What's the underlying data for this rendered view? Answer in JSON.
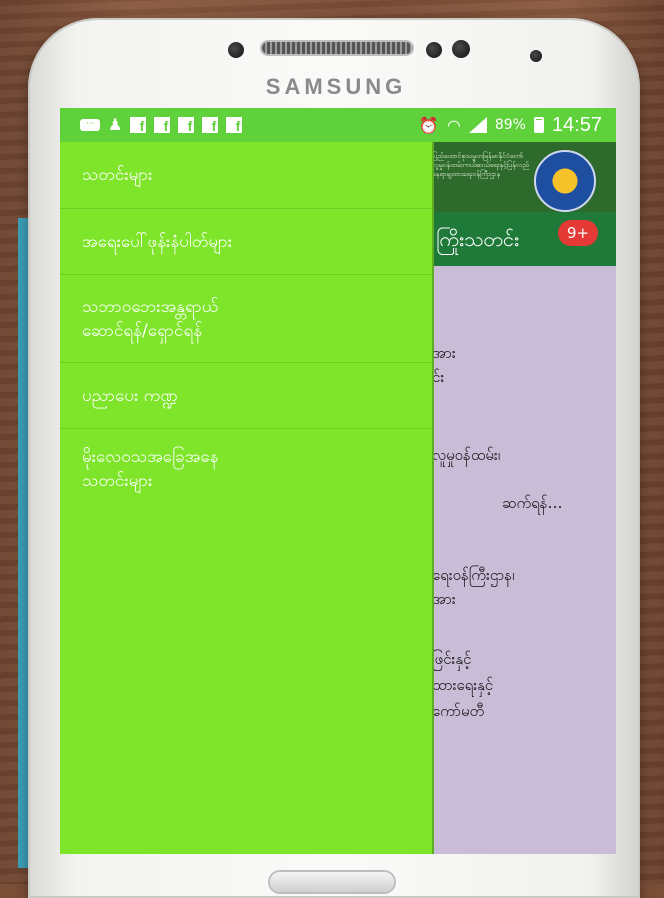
{
  "device": {
    "brand": "SAMSUNG"
  },
  "status_bar": {
    "battery": "89%",
    "time": "14:57",
    "notification_icons": [
      "message-icon",
      "person-icon",
      "facebook-icon",
      "facebook-icon",
      "facebook-icon",
      "facebook-icon",
      "facebook-icon",
      "alarm-icon",
      "wifi-icon",
      "signal-icon",
      "battery-icon"
    ]
  },
  "drawer": {
    "items": [
      {
        "label": "သတင်းများ"
      },
      {
        "label": "အရေးပေါ်ဖုန်းနံပါတ်များ"
      },
      {
        "label": "သဘာဝဘေးအန္တရာယ်\nဆောင်ရန်/ရှောင်ရန်"
      },
      {
        "label": "ပညာပေး ကဏ္ဍ"
      },
      {
        "label": "မိုးလေဝသအခြေအနေ\nသတင်းများ"
      }
    ]
  },
  "app": {
    "header_text": "ပြည်ထောင်စုသမ္မတမြန်မာနိုင်ငံတော် လူမှုဝန်ထမ်းကယ်ဆယ်ရေးနှင့်ပြန်လည်နေရာချထားရေးဝန်ကြီးဌာန",
    "tab_label": "ကြိုးသတင်း",
    "badge": "9+",
    "body_lines": [
      "အား",
      "င်း",
      "လူမှုဝန်ထမ်း၊",
      "ဆက်ရန်…",
      "ရေးဝန်ကြီးဌာန၊",
      "အား",
      "ဖြင်းနှင့်",
      "ထားရေးနှင့်",
      "ကော်မတီ"
    ]
  },
  "colors": {
    "drawer_bg": "#7ee52a",
    "status_bar_bg": "#5fd13b",
    "app_header_bg": "#2f6a2d",
    "badge_bg": "#e53935"
  }
}
